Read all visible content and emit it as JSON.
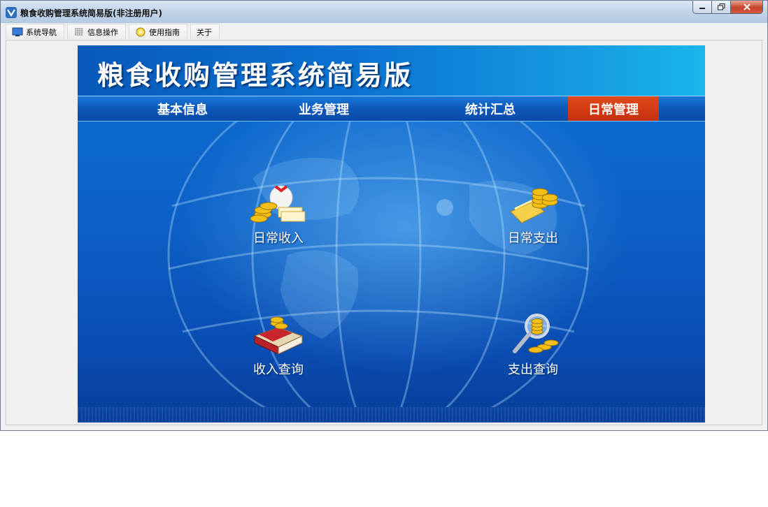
{
  "window": {
    "title": "粮食收购管理系统简易版(非注册用户)"
  },
  "menu": {
    "items": [
      {
        "label": "系统导航",
        "icon": "monitor-icon"
      },
      {
        "label": "信息操作",
        "icon": "grid-icon"
      },
      {
        "label": "使用指南",
        "icon": "help-icon"
      },
      {
        "label": "关于",
        "icon": ""
      }
    ]
  },
  "banner": {
    "title": "粮食收购管理系统简易版"
  },
  "nav": {
    "items": [
      {
        "label": "基本信息",
        "active": false
      },
      {
        "label": "业务管理",
        "active": false
      },
      {
        "label": "统计汇总",
        "active": false
      },
      {
        "label": "日常管理",
        "active": true
      }
    ]
  },
  "tiles": [
    {
      "label": "日常收入",
      "icon": "money-bag-icon"
    },
    {
      "label": "日常支出",
      "icon": "gold-coins-icon"
    },
    {
      "label": "收入查询",
      "icon": "ledger-book-icon"
    },
    {
      "label": "支出查询",
      "icon": "magnifier-coins-icon"
    }
  ],
  "colors": {
    "active_nav": "#d13a14",
    "panel_blue": "#0c61c7"
  }
}
